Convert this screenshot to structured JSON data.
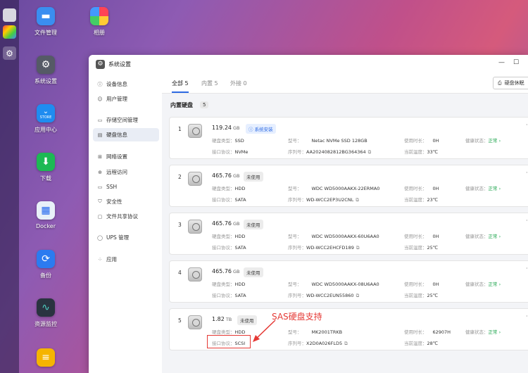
{
  "desktop": {
    "icons": [
      {
        "id": "file-manager",
        "label": "文件管理"
      },
      {
        "id": "photos",
        "label": "相册"
      },
      {
        "id": "settings",
        "label": "系统设置"
      },
      {
        "id": "app-center",
        "label": "应用中心",
        "sub": "STORE"
      },
      {
        "id": "download",
        "label": "下载"
      },
      {
        "id": "docker",
        "label": "Docker"
      },
      {
        "id": "backup",
        "label": "备份"
      },
      {
        "id": "resource-monitor",
        "label": "资源监控"
      }
    ]
  },
  "window": {
    "title": "系统设置"
  },
  "sidebar": {
    "items": [
      {
        "label": "设备信息",
        "icon": "info-icon"
      },
      {
        "label": "用户管理",
        "icon": "user-icon"
      },
      {
        "label": "存储空间管理",
        "icon": "storage-icon"
      },
      {
        "label": "硬盘信息",
        "icon": "disk-icon",
        "active": true
      },
      {
        "label": "网络设置",
        "icon": "network-icon"
      },
      {
        "label": "远程访问",
        "icon": "remote-icon"
      },
      {
        "label": "SSH",
        "icon": "ssh-icon"
      },
      {
        "label": "安全性",
        "icon": "shield-icon"
      },
      {
        "label": "文件共享协议",
        "icon": "share-icon"
      },
      {
        "label": "UPS 管理",
        "icon": "ups-icon"
      },
      {
        "label": "应用",
        "icon": "apps-icon"
      }
    ]
  },
  "tabs": [
    {
      "label": "全部",
      "count": "5"
    },
    {
      "label": "内置",
      "count": "5"
    },
    {
      "label": "外接",
      "count": "0"
    }
  ],
  "toolbar": {
    "sleep_label": "硬盘休眠"
  },
  "section": {
    "title": "内置硬盘",
    "count": "5"
  },
  "field_labels": {
    "type": "硬盘类型：",
    "iface": "接口协议：",
    "model": "型号：",
    "serial": "序列号：",
    "usage": "使用时长：",
    "temp": "当前温度：",
    "health": "健康状态："
  },
  "disks": [
    {
      "index": "1",
      "capacity": "119.24",
      "unit": "GB",
      "badge": "系统安装",
      "type": "SSD",
      "iface": "NVMe",
      "model": "Netac NVMe SSD 128GB",
      "serial": "AA2024082812BG364364",
      "usage": "0H",
      "temp": "33℃",
      "health": "正常"
    },
    {
      "index": "2",
      "capacity": "465.76",
      "unit": "GB",
      "badge": "未使用",
      "type": "HDD",
      "iface": "SATA",
      "model": "WDC WD5000AAKX-22ERMA0",
      "serial": "WD-WCC2EP3U2CNL",
      "usage": "0H",
      "temp": "23℃",
      "health": "正常"
    },
    {
      "index": "3",
      "capacity": "465.76",
      "unit": "GB",
      "badge": "未使用",
      "type": "HDD",
      "iface": "SATA",
      "model": "WDC WD5000AAKX-60U6AA0",
      "serial": "WD-WCC2EHCFD189",
      "usage": "0H",
      "temp": "25℃",
      "health": "正常"
    },
    {
      "index": "4",
      "capacity": "465.76",
      "unit": "GB",
      "badge": "未使用",
      "type": "HDD",
      "iface": "SATA",
      "model": "WDC WD5000AAKX-08U6AA0",
      "serial": "WD-WCC2EUN55860",
      "usage": "0H",
      "temp": "25℃",
      "health": "正常"
    },
    {
      "index": "5",
      "capacity": "1.82",
      "unit": "TB",
      "badge": "未使用",
      "type": "HDD",
      "iface": "SCSI",
      "model": "MK2001TRKB",
      "serial": "X2D0A026FLD5",
      "usage": "62907H",
      "temp": "28℃",
      "health": "正常"
    }
  ],
  "annotation": {
    "text": "SAS硬盘支持"
  }
}
